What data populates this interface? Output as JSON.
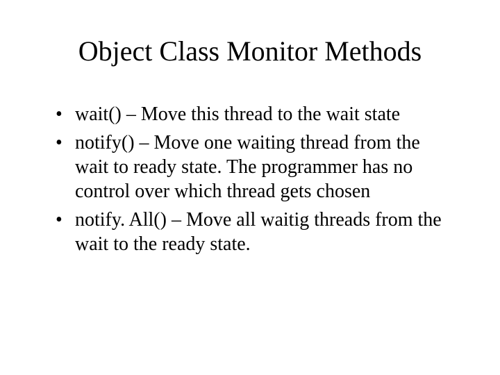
{
  "title": "Object Class Monitor Methods",
  "bullets": [
    "wait() – Move this thread to the wait state",
    "notify() – Move one waiting thread from the wait to ready state. The programmer has no control over which thread gets chosen",
    "notify. All() – Move all waitig threads from the wait to the ready state."
  ]
}
